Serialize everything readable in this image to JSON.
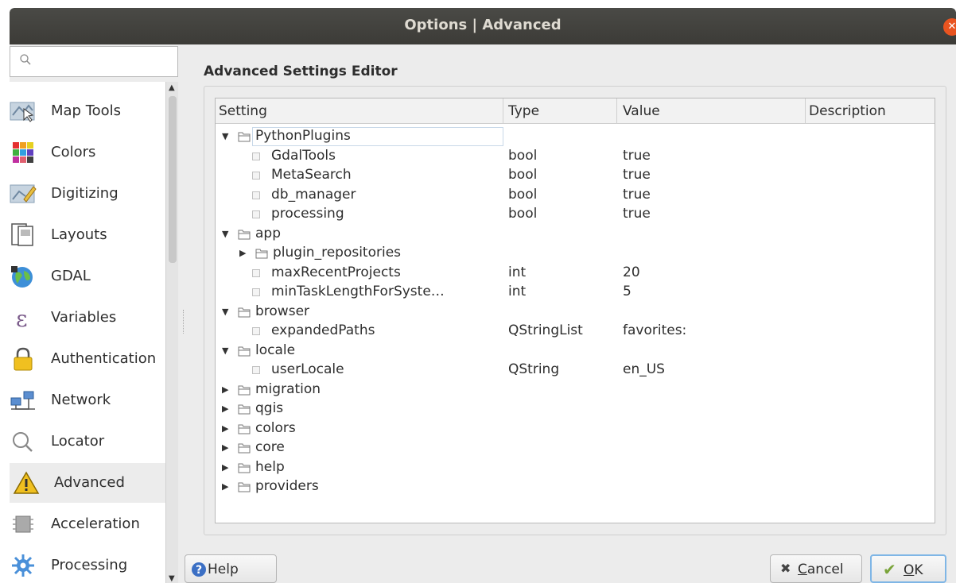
{
  "window": {
    "title": "Options | Advanced"
  },
  "search": {
    "placeholder": ""
  },
  "sidebar": {
    "items": [
      {
        "label": "Map Tools",
        "icon": "map-tools-icon"
      },
      {
        "label": "Colors",
        "icon": "colors-icon"
      },
      {
        "label": "Digitizing",
        "icon": "digitizing-icon"
      },
      {
        "label": "Layouts",
        "icon": "layouts-icon"
      },
      {
        "label": "GDAL",
        "icon": "gdal-icon"
      },
      {
        "label": "Variables",
        "icon": "variables-icon"
      },
      {
        "label": "Authentication",
        "icon": "lock-icon"
      },
      {
        "label": "Network",
        "icon": "network-icon"
      },
      {
        "label": "Locator",
        "icon": "search-icon"
      },
      {
        "label": "Advanced",
        "icon": "warning-icon",
        "selected": true
      },
      {
        "label": "Acceleration",
        "icon": "chip-icon"
      },
      {
        "label": "Processing",
        "icon": "gear-icon"
      }
    ]
  },
  "main": {
    "heading": "Advanced Settings Editor",
    "columns": {
      "setting": "Setting",
      "type": "Type",
      "value": "Value",
      "description": "Description"
    },
    "rows": [
      {
        "name": "PythonPlugins",
        "kind": "folder",
        "expanded": true,
        "level": 0,
        "type": "",
        "value": ""
      },
      {
        "name": "GdalTools",
        "kind": "leaf",
        "level": 1,
        "type": "bool",
        "value": "true"
      },
      {
        "name": "MetaSearch",
        "kind": "leaf",
        "level": 1,
        "type": "bool",
        "value": "true"
      },
      {
        "name": "db_manager",
        "kind": "leaf",
        "level": 1,
        "type": "bool",
        "value": "true"
      },
      {
        "name": "processing",
        "kind": "leaf",
        "level": 1,
        "type": "bool",
        "value": "true"
      },
      {
        "name": "app",
        "kind": "folder",
        "expanded": true,
        "level": 0,
        "type": "",
        "value": ""
      },
      {
        "name": "plugin_repositories",
        "kind": "folder",
        "expanded": false,
        "level": 1,
        "type": "",
        "value": ""
      },
      {
        "name": "maxRecentProjects",
        "kind": "leaf",
        "level": 1,
        "type": "int",
        "value": "20"
      },
      {
        "name": "minTaskLengthForSyste…",
        "kind": "leaf",
        "level": 1,
        "type": "int",
        "value": "5"
      },
      {
        "name": "browser",
        "kind": "folder",
        "expanded": true,
        "level": 0,
        "type": "",
        "value": ""
      },
      {
        "name": "expandedPaths",
        "kind": "leaf",
        "level": 1,
        "type": "QStringList",
        "value": "favorites:"
      },
      {
        "name": "locale",
        "kind": "folder",
        "expanded": true,
        "level": 0,
        "type": "",
        "value": ""
      },
      {
        "name": "userLocale",
        "kind": "leaf",
        "level": 1,
        "type": "QString",
        "value": "en_US"
      },
      {
        "name": "migration",
        "kind": "folder",
        "expanded": false,
        "level": 0,
        "type": "",
        "value": ""
      },
      {
        "name": "qgis",
        "kind": "folder",
        "expanded": false,
        "level": 0,
        "type": "",
        "value": ""
      },
      {
        "name": "colors",
        "kind": "folder",
        "expanded": false,
        "level": 0,
        "type": "",
        "value": ""
      },
      {
        "name": "core",
        "kind": "folder",
        "expanded": false,
        "level": 0,
        "type": "",
        "value": ""
      },
      {
        "name": "help",
        "kind": "folder",
        "expanded": false,
        "level": 0,
        "type": "",
        "value": ""
      },
      {
        "name": "providers",
        "kind": "folder",
        "expanded": false,
        "level": 0,
        "type": "",
        "value": ""
      }
    ]
  },
  "buttons": {
    "help": "Help",
    "cancel_first": "C",
    "cancel_rest": "ancel",
    "ok_first": "O",
    "ok_rest": "K"
  },
  "colors": {
    "accent": "#e95420",
    "titlebar": "#3c3b37",
    "ok_border": "#7fb6e6"
  }
}
